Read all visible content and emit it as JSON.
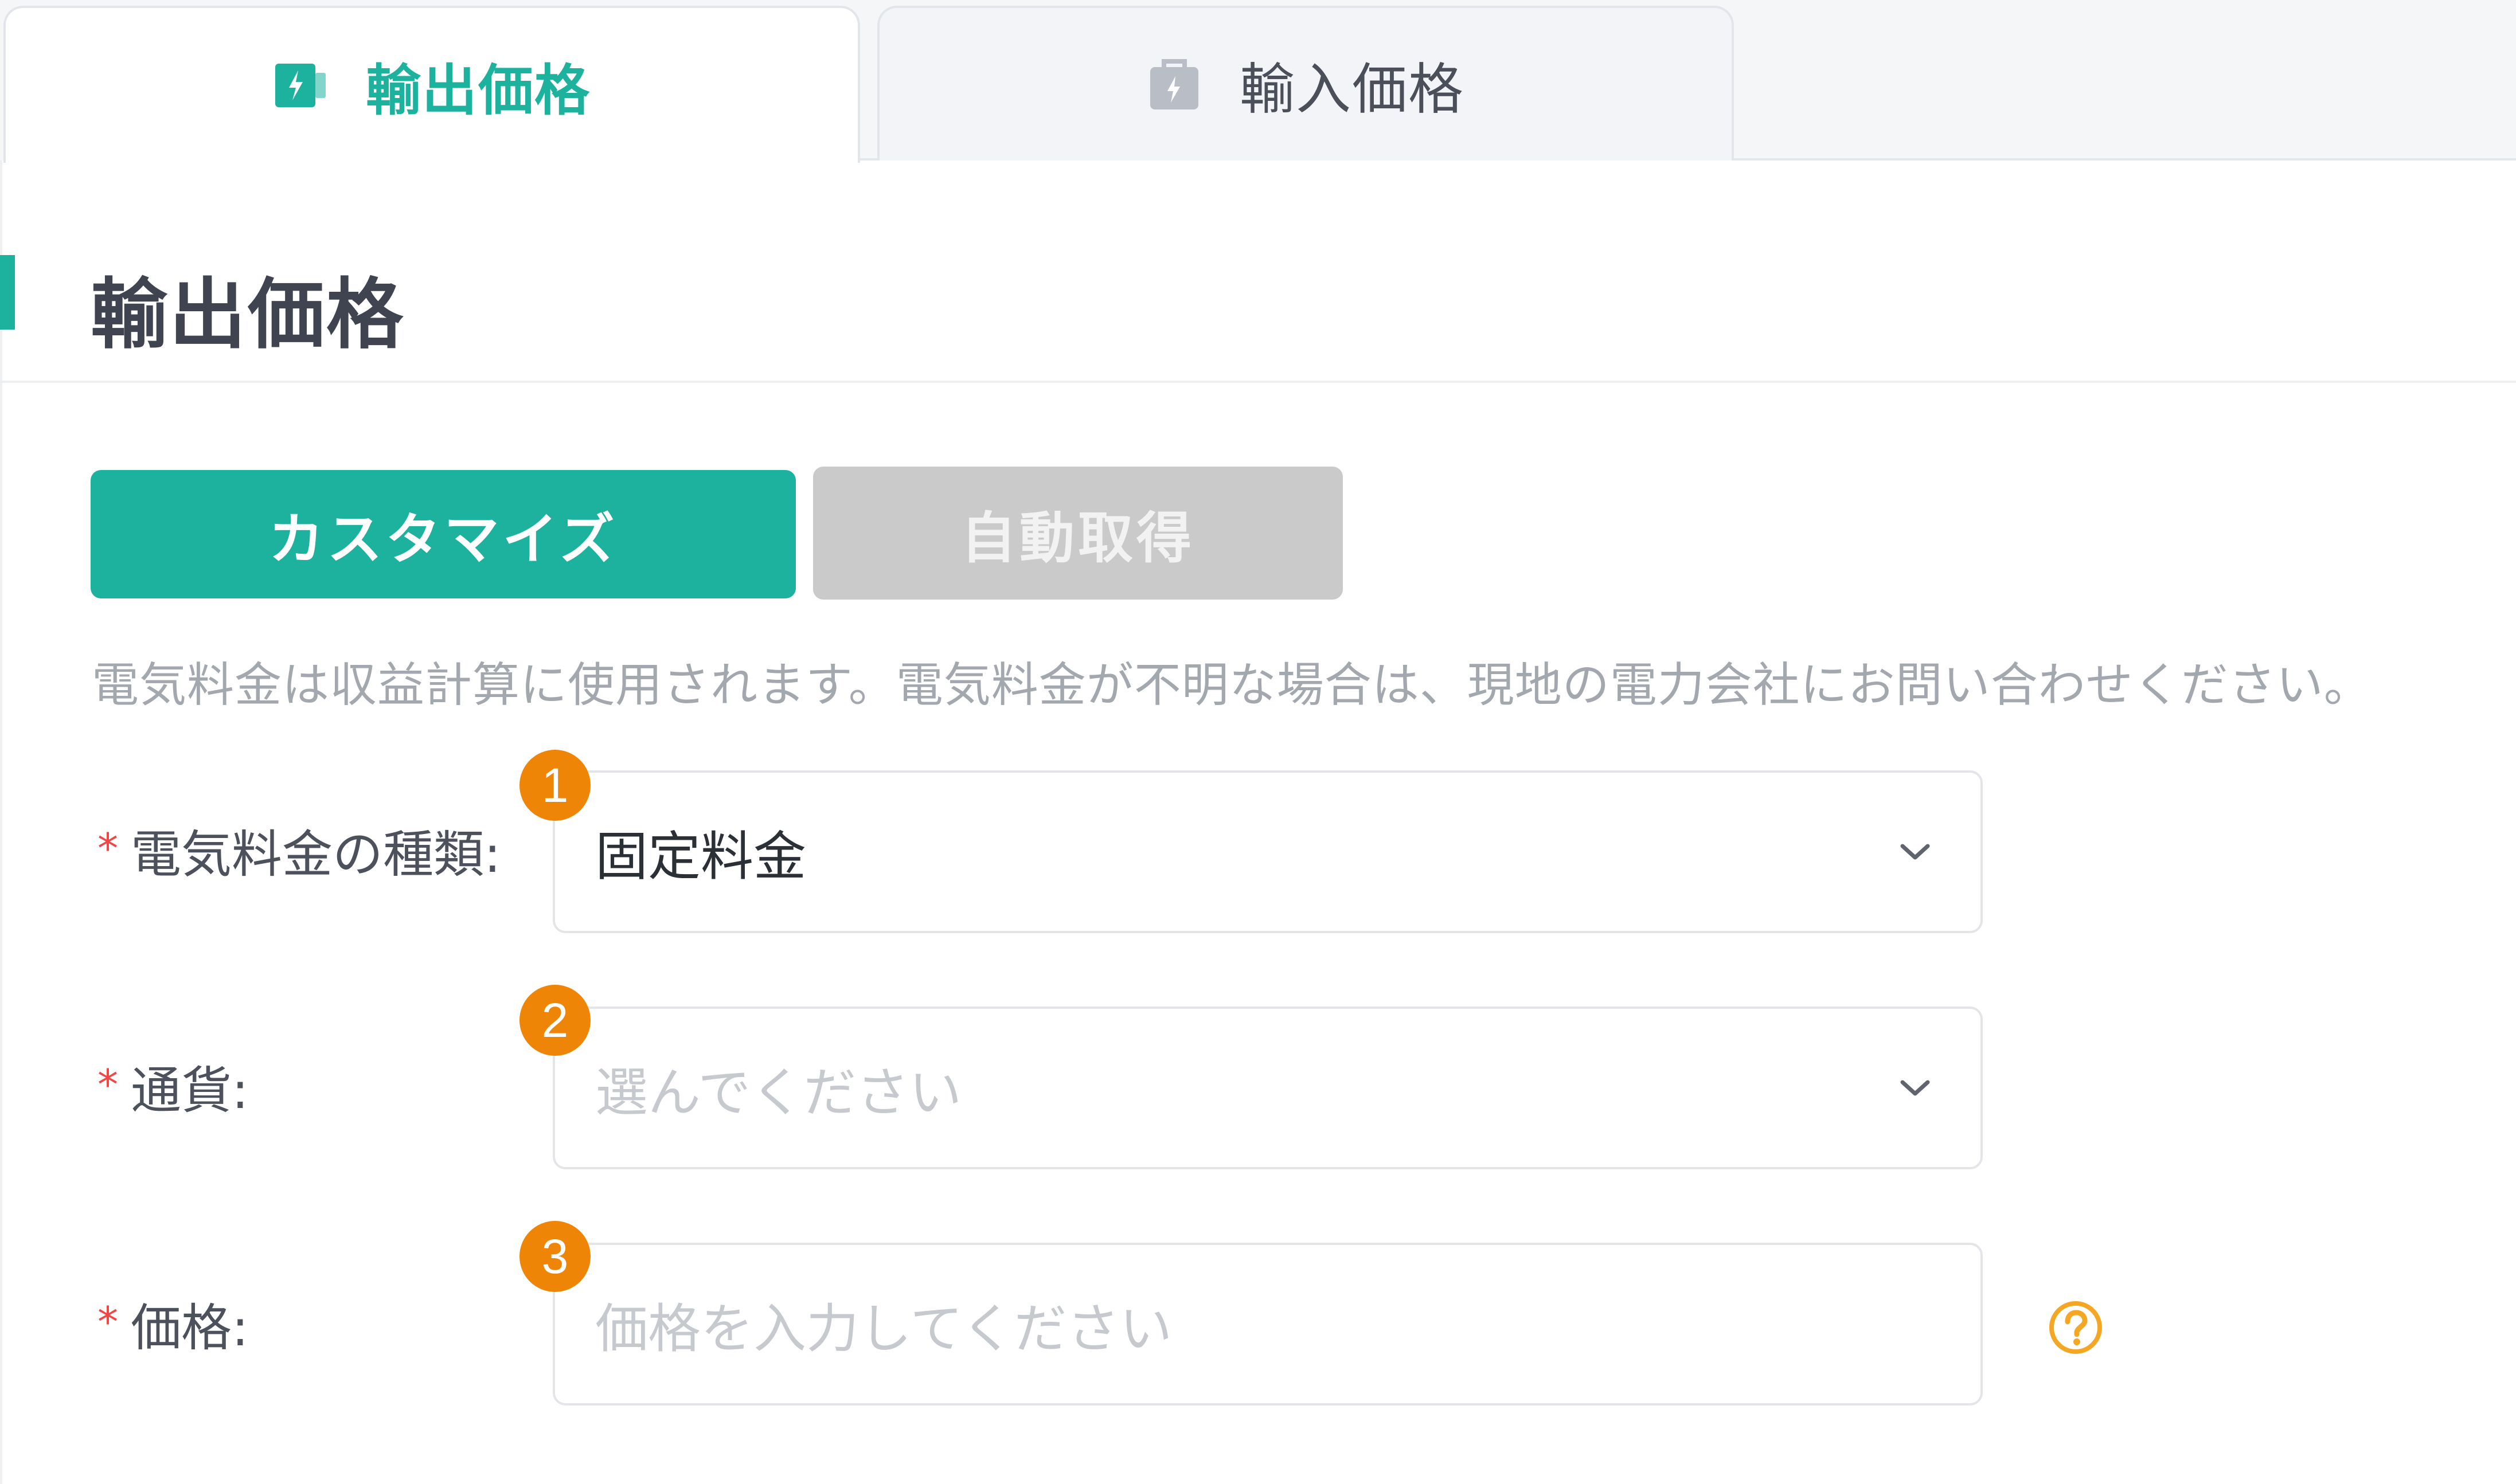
{
  "tabs": [
    {
      "label": "輸出価格",
      "icon": "export-power-icon",
      "active": true
    },
    {
      "label": "輸入価格",
      "icon": "import-power-icon",
      "active": false
    }
  ],
  "section": {
    "title": "輸出価格"
  },
  "modes": {
    "custom_label": "カスタマイズ",
    "auto_label": "自動取得"
  },
  "description": "電気料金は収益計算に使用されます。電気料金が不明な場合は、現地の電力会社にお問い合わせください。",
  "form": {
    "required_mark": "*",
    "rows": [
      {
        "badge": "1",
        "label": "電気料金の種類:",
        "value": "固定料金",
        "placeholder": ""
      },
      {
        "badge": "2",
        "label": "通貨:",
        "value": "",
        "placeholder": "選んでください"
      },
      {
        "badge": "3",
        "label": "価格:",
        "value": "",
        "placeholder": "価格を入力してください"
      }
    ]
  },
  "colors": {
    "accent": "#1cb29e",
    "badge": "#ef8507",
    "required": "#f04646",
    "help": "#f5a623",
    "disabled_button": "#cacaca"
  }
}
